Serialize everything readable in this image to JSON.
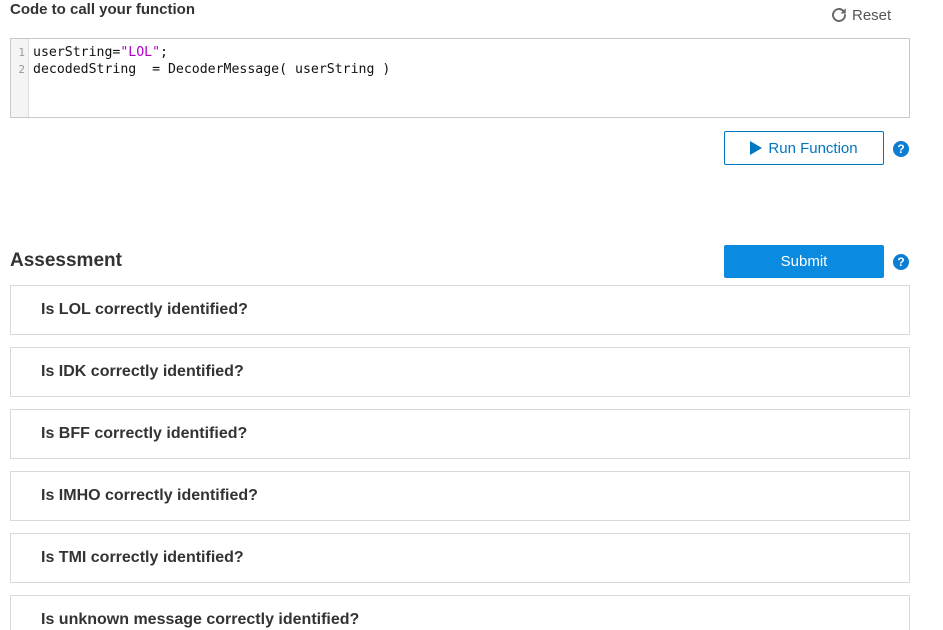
{
  "code_section": {
    "title": "Code to call your function",
    "reset_label": "Reset",
    "line_numbers": [
      "1",
      "2"
    ],
    "line1_prefix": "userString=",
    "line1_string": "\"LOL\"",
    "line1_suffix": ";",
    "line2": "decodedString  = DecoderMessage( userString )",
    "run_label": "Run Function",
    "help_glyph": "?"
  },
  "assessment": {
    "title": "Assessment",
    "submit_label": "Submit",
    "help_glyph": "?",
    "items": [
      "Is LOL correctly identified?",
      "Is IDK correctly identified?",
      "Is BFF correctly identified?",
      "Is IMHO correctly identified?",
      "Is TMI correctly identified?",
      "Is unknown message correctly identified?"
    ]
  },
  "colors": {
    "accent": "#0076c0",
    "submit_bg": "#0b8be0",
    "string_literal": "#b100c8"
  },
  "icons": {
    "reset": "refresh-icon",
    "run": "play-icon",
    "help": "help-icon"
  }
}
